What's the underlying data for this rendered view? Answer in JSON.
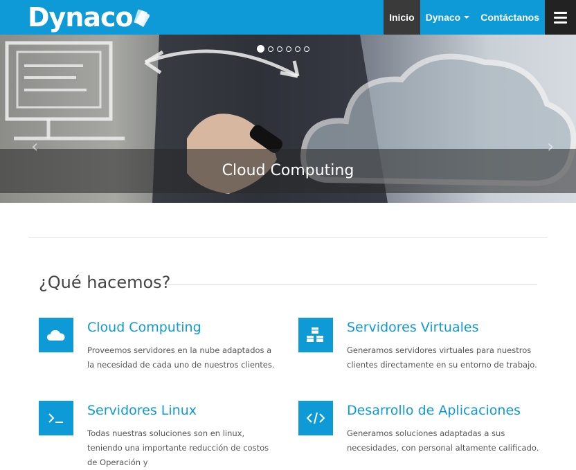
{
  "brand": {
    "name": "Dynaco"
  },
  "nav": {
    "items": [
      {
        "label": "Inicio",
        "active": true
      },
      {
        "label": "Dynaco",
        "dropdown": true
      },
      {
        "label": "Contáctanos"
      }
    ]
  },
  "carousel": {
    "caption": "Cloud Computing",
    "slides": 6,
    "active_slide": 1
  },
  "section": {
    "title": "¿Qué hacemos?"
  },
  "features": [
    {
      "icon": "cloud-icon",
      "title": "Cloud Computing",
      "text": "Proveemos servidores en la nube adaptados a la necesidad de cada uno de nuestros clientes."
    },
    {
      "icon": "cubes-icon",
      "title": "Servidores Virtuales",
      "text": "Generamos servidores virtuales para nuestros clientes directamente en su entorno de trabajo."
    },
    {
      "icon": "terminal-icon",
      "title": "Servidores Linux",
      "text": "Todas nuestras soluciones son en linux, teniendo una importante reducción de costos de Operación y"
    },
    {
      "icon": "code-icon",
      "title": "Desarrollo de Aplicaciones",
      "text": "Generamos soluciones adaptadas a sus necesidades, con personal altamente calificado."
    }
  ],
  "colors": {
    "brand": "#0e9ad7",
    "nav_active": "#3a3a3a",
    "menu_button": "#222222"
  }
}
